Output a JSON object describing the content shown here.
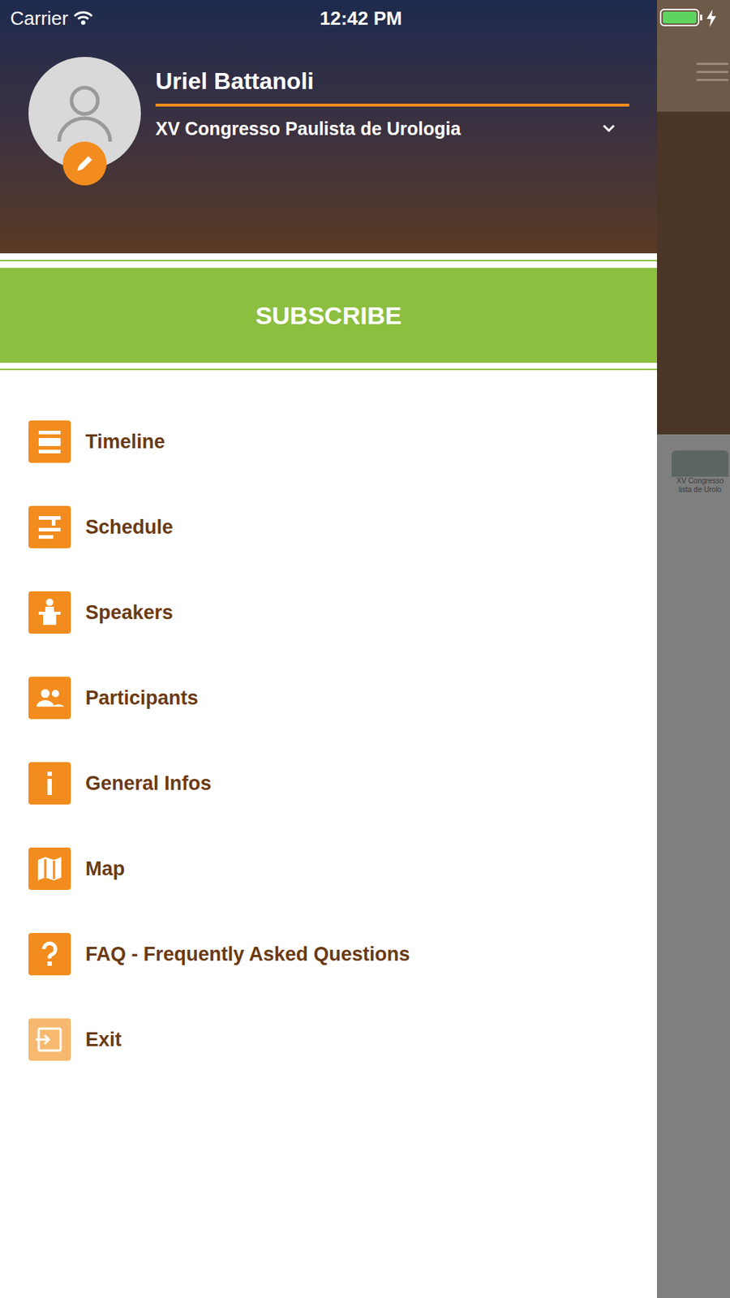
{
  "status_bar": {
    "carrier": "Carrier",
    "time": "12:42 PM"
  },
  "profile": {
    "name": "Uriel Battanoli",
    "event": "XV Congresso Paulista de Urologia"
  },
  "subscribe_button": "SUBSCRIBE",
  "menu": {
    "items": [
      {
        "label": "Timeline",
        "muted": false
      },
      {
        "label": "Schedule",
        "muted": false
      },
      {
        "label": "Speakers",
        "muted": false
      },
      {
        "label": "Participants",
        "muted": false
      },
      {
        "label": "General Infos",
        "muted": false
      },
      {
        "label": "Map",
        "muted": false
      },
      {
        "label": "FAQ - Frequently Asked Questions",
        "muted": false
      },
      {
        "label": "Exit",
        "muted": true
      }
    ]
  },
  "background": {
    "logo_lines": [
      "XV Congresso",
      "lista de Urolo"
    ]
  }
}
